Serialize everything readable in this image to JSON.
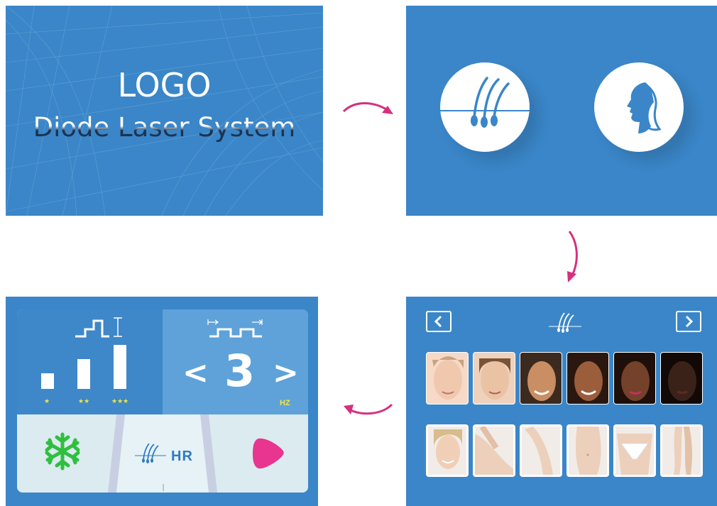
{
  "splash": {
    "logo": "LOGO",
    "subtitle": "Diode Laser System"
  },
  "mode_select": {
    "options": [
      {
        "name": "hair-removal",
        "icon": "hair-follicle-icon"
      },
      {
        "name": "face",
        "icon": "face-profile-icon"
      }
    ]
  },
  "skin_select": {
    "header_icon": "hair-follicle-icon",
    "prev_icon": "chevron-left-icon",
    "next_icon": "chevron-right-icon",
    "skin_tones": [
      "#f6d9c6",
      "#eac3a4",
      "#c98e63",
      "#9b5d3b",
      "#74412a",
      "#3b2218"
    ],
    "body_areas": [
      "face",
      "underarm",
      "arm",
      "abdomen",
      "bikini",
      "legs"
    ]
  },
  "treatment": {
    "energy_levels": [
      {
        "stars": "★",
        "level": 1
      },
      {
        "stars": "★★",
        "level": 2
      },
      {
        "stars": "★★★",
        "level": 3
      }
    ],
    "frequency": {
      "value": "3",
      "unit": "HZ"
    },
    "mode_label": "HR",
    "cool_icon": "snowflake-icon",
    "start_icon": "play-icon",
    "colors": {
      "snowflake": "#2fbf3f",
      "start": "#e8358f",
      "stars": "#f0e64a",
      "flow_arrow": "#d6307f"
    }
  },
  "flow_arrows": [
    "arrow-right",
    "arrow-down",
    "arrow-left"
  ]
}
